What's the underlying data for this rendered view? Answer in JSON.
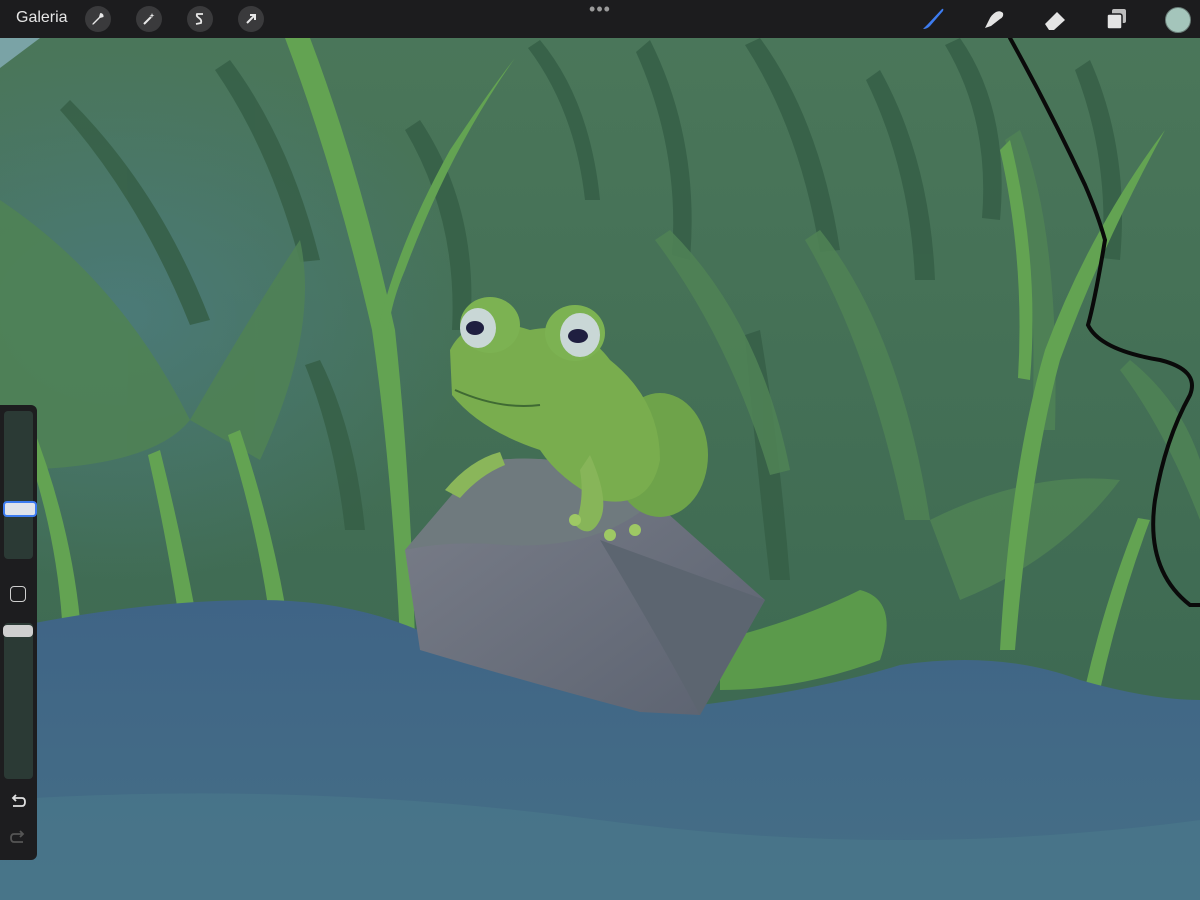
{
  "toolbar": {
    "gallery_label": "Galeria",
    "left_tools": [
      {
        "name": "actions",
        "icon": "wrench-icon"
      },
      {
        "name": "adjustments",
        "icon": "magic-wand-icon"
      },
      {
        "name": "selection",
        "icon": "selection-s-icon"
      },
      {
        "name": "transform",
        "icon": "arrow-cursor-icon"
      }
    ],
    "more_label": "•••",
    "right_tools": [
      {
        "name": "brush",
        "icon": "brush-icon",
        "active": true
      },
      {
        "name": "smudge",
        "icon": "smudge-icon",
        "active": false
      },
      {
        "name": "eraser",
        "icon": "eraser-icon",
        "active": false
      },
      {
        "name": "layers",
        "icon": "layers-icon",
        "active": false
      }
    ],
    "current_color": "#a4c5bb",
    "accent_color": "#3d7cf0"
  },
  "sidebar": {
    "brush_size_level": 0.33,
    "opacity_level": 1.0,
    "undo_icon": "undo-icon",
    "redo_icon": "redo-icon",
    "modify_icon": "square-icon"
  }
}
